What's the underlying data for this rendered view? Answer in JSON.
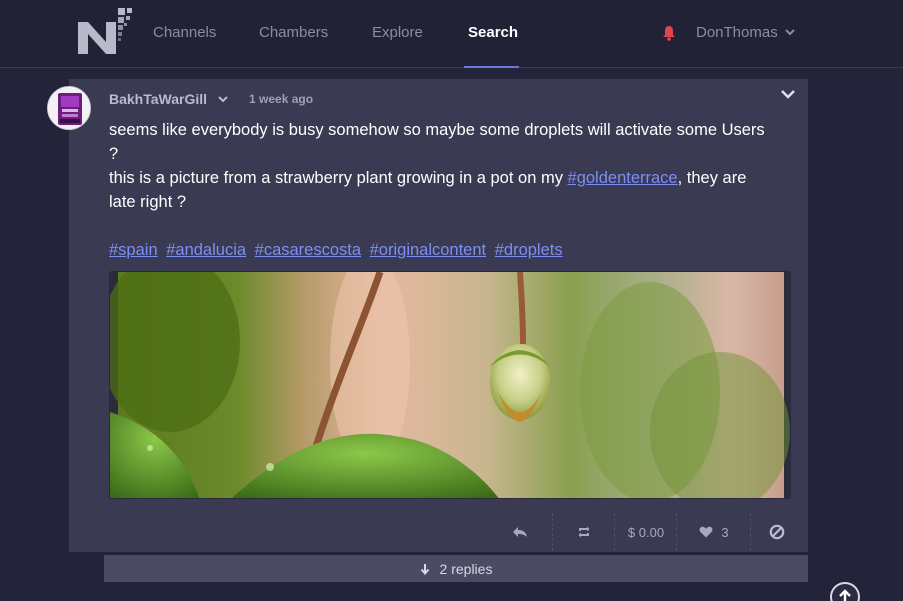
{
  "nav": {
    "links": [
      "Channels",
      "Chambers",
      "Explore",
      "Search"
    ],
    "active": "Search",
    "username": "DonThomas"
  },
  "post": {
    "author": "BakhTaWarGill",
    "time": "1 week ago",
    "text_line1": "seems like everybody is busy somehow so maybe some droplets will activate some Users",
    "text_line2": "?",
    "text_line3_before": "this is a picture from a strawberry plant growing in a pot on my ",
    "text_line3_tag": "#goldenterrace",
    "text_line3_after": ", they are",
    "text_line4": "late right ?",
    "tags": [
      "#spain",
      "#andalucia",
      "#casarescosta",
      "#originalcontent",
      "#droplets"
    ]
  },
  "actions": {
    "payout": "$ 0.00",
    "likes": "3"
  },
  "replies": {
    "label": "2 replies"
  },
  "colors": {
    "background": "#232339",
    "card": "#3a3a52",
    "link": "#7c8ff4",
    "notification": "#e0444c"
  }
}
